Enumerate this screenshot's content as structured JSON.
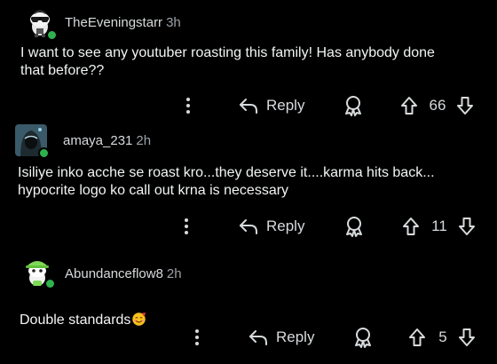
{
  "comments": [
    {
      "username": "TheEveningstarr",
      "time": "3h",
      "text": "I want to see any youtuber roasting this family! Has anybody done\nthat before??",
      "reply_label": "Reply",
      "votes": "66",
      "avatar": "snoo-sunglasses-avatar"
    },
    {
      "username": "amaya_231",
      "time": "2h",
      "text": "Isiliye inko acche se roast kro...they deserve it....karma hits back...\nhypocrite logo ko call out krna is necessary",
      "reply_label": "Reply",
      "votes": "11",
      "avatar": "hooded-figure-avatar"
    },
    {
      "username": "Abundanceflow8",
      "time": "2h",
      "text": "Double standards",
      "reply_label": "Reply",
      "votes": "5",
      "avatar": "green-hat-snoo-avatar",
      "emoji": "smiling-face-with-hearts-emoji"
    }
  ],
  "colors": {
    "background": "#000000",
    "text": "#f2f4f5",
    "muted": "#9da3a8",
    "online": "#2fb24e"
  }
}
